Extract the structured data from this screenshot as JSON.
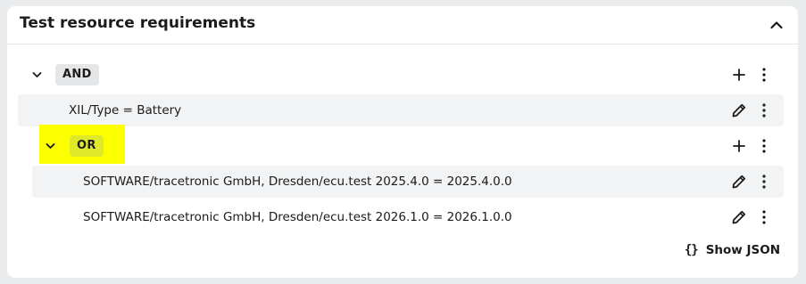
{
  "card": {
    "title": "Test resource requirements",
    "collapse_icon": "chevron-up-icon"
  },
  "tree": {
    "root": {
      "operator": "AND",
      "expanded": true,
      "actions": [
        "add-icon",
        "more-vertical-icon"
      ]
    },
    "condition_1": {
      "text": "XIL/Type = Battery",
      "actions": [
        "edit-pencil-icon",
        "more-vertical-icon"
      ]
    },
    "group": {
      "operator": "OR",
      "expanded": true,
      "highlighted": true,
      "highlight_color": "#fbff00",
      "actions": [
        "add-icon",
        "more-vertical-icon"
      ]
    },
    "condition_2": {
      "text": "SOFTWARE/tracetronic GmbH, Dresden/ecu.test 2025.4.0 = 2025.4.0.0",
      "actions": [
        "edit-pencil-icon",
        "more-vertical-icon"
      ]
    },
    "condition_3": {
      "text": "SOFTWARE/tracetronic GmbH, Dresden/ecu.test 2026.1.0 = 2026.1.0.0",
      "actions": [
        "edit-pencil-icon",
        "more-vertical-icon"
      ]
    }
  },
  "footer": {
    "show_json_icon": "{}",
    "show_json_label": "Show JSON"
  },
  "colors": {
    "background": "#e9ebec",
    "card": "#ffffff",
    "row_shade": "#f2f3f4",
    "and_badge": "#e4e6e8",
    "or_badge": "#e0e82a",
    "highlight": "#fbff00"
  }
}
